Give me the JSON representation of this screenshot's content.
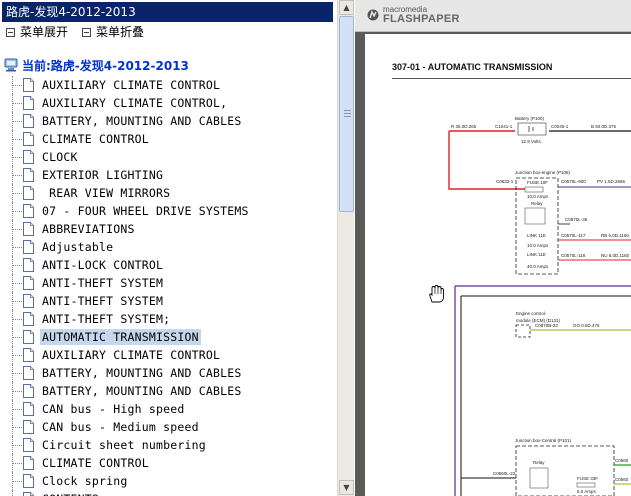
{
  "left_pane": {
    "title": "路虎-发现4-2012-2013",
    "controls": {
      "expand_label": "菜单展开",
      "collapse_label": "菜单折叠"
    },
    "root_label": "当前:路虎-发现4-2012-2013",
    "items": [
      {
        "label": "AUXILIARY CLIMATE CONTROL",
        "selected": false
      },
      {
        "label": "AUXILIARY CLIMATE CONTROL,",
        "selected": false
      },
      {
        "label": "BATTERY, MOUNTING AND CABLES",
        "selected": false
      },
      {
        "label": "CLIMATE CONTROL",
        "selected": false
      },
      {
        "label": "CLOCK",
        "selected": false
      },
      {
        "label": "EXTERIOR LIGHTING",
        "selected": false
      },
      {
        "label": " REAR VIEW MIRRORS",
        "selected": false
      },
      {
        "label": "07 - FOUR WHEEL DRIVE SYSTEMS",
        "selected": false
      },
      {
        "label": "ABBREVIATIONS",
        "selected": false
      },
      {
        "label": "Adjustable",
        "selected": false
      },
      {
        "label": "ANTI-LOCK CONTROL",
        "selected": false
      },
      {
        "label": "ANTI-THEFT SYSTEM",
        "selected": false
      },
      {
        "label": "ANTI-THEFT SYSTEM",
        "selected": false
      },
      {
        "label": "ANTI-THEFT SYSTEM;",
        "selected": false
      },
      {
        "label": "AUTOMATIC TRANSMISSION",
        "selected": true
      },
      {
        "label": "AUXILIARY CLIMATE CONTROL",
        "selected": false
      },
      {
        "label": "BATTERY, MOUNTING AND CABLES",
        "selected": false
      },
      {
        "label": "BATTERY, MOUNTING AND CABLES",
        "selected": false
      },
      {
        "label": "CAN bus - High speed",
        "selected": false
      },
      {
        "label": "CAN bus - Medium speed",
        "selected": false
      },
      {
        "label": "Circuit sheet numbering",
        "selected": false
      },
      {
        "label": "CLIMATE CONTROL",
        "selected": false
      },
      {
        "label": "Clock spring",
        "selected": false
      },
      {
        "label": "CONTENTS",
        "selected": false
      }
    ]
  },
  "viewer": {
    "brand_small": "macromedia",
    "brand_large": "FLASHPAPER",
    "page_heading": "307-01 - AUTOMATIC TRANSMISSION",
    "diagram_labels": {
      "battery": "Battery (P100)",
      "battery_value": "12.9 Volts",
      "jb_engine": "Junction box-engine (P108)",
      "fuse": "FUSE 10F",
      "fuse_value": "10.0 Amps",
      "relay": "Relay",
      "link1": "LINK 11E",
      "link1_value": "10.0 Amps",
      "link2": "LINK 11E",
      "link2_value": "40.0 Amps",
      "ecm1": "Engine control-",
      "ecm2": "module (ECM) (D131)",
      "jb_central": "Junction box-Central (P101)",
      "fuse2": "FUSE 33F",
      "fuse2_value": "5.0 Amps",
      "w1": "R 35.0D.265",
      "w2": "C1041-1",
      "w3": "C0045-1",
      "w4": "B 50.0D.375",
      "w5": "C0632-1",
      "w6": "C0570L-900",
      "w7": "PV 1.5D.2686",
      "w8": "C0570L-36",
      "w9": "C0570L-117",
      "w10": "RB 6.0D.1160",
      "w11": "C0570L-116",
      "w12": "NU 6.0D.1160",
      "w13": "C0870B-33",
      "w14": "GO 0.5D.475",
      "w15": "C0560L-22",
      "w16": "C0560",
      "w17": "C0560"
    }
  },
  "colors": {
    "title_bg": "#0a246a",
    "root_text": "#0033cc",
    "selected_bg": "#c4d7ec",
    "wire_red": "#e02020",
    "wire_purple": "#5a2a8a",
    "wire_green": "#2a9a2a",
    "wire_yellowgreen": "#a8c23a"
  }
}
